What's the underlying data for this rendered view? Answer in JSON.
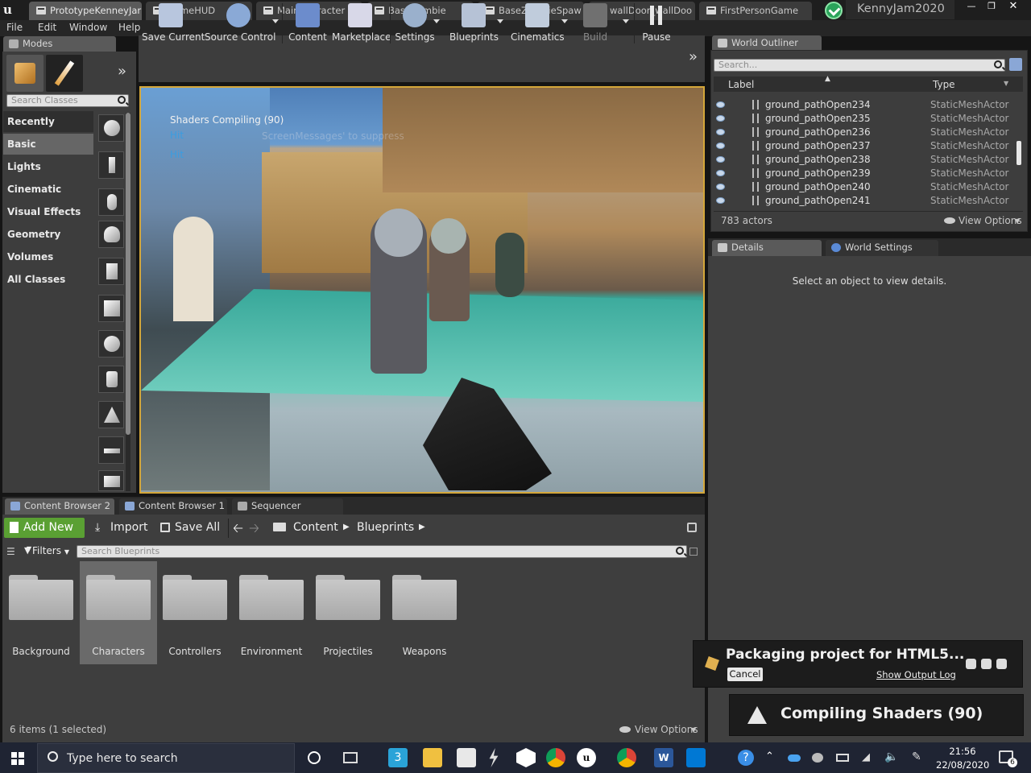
{
  "window": {
    "tabs": [
      {
        "label": "PrototypeKenneyJar"
      },
      {
        "label": "GameHUD"
      },
      {
        "label": "MainCharacter"
      },
      {
        "label": "BaseZombie"
      },
      {
        "label": "BaseZombieSpaw"
      },
      {
        "label": "wallDoor_wallDoo"
      },
      {
        "label": "FirstPersonGame"
      }
    ],
    "project_name": "KennyJam2020"
  },
  "menu": {
    "items": [
      "File",
      "Edit",
      "Window",
      "Help"
    ]
  },
  "modes": {
    "tab_label": "Modes",
    "search_placeholder": "Search Classes",
    "categories": [
      "Recently Placed",
      "Basic",
      "Lights",
      "Cinematic",
      "Visual Effects",
      "Geometry",
      "Volumes",
      "All Classes"
    ]
  },
  "toolbar": {
    "buttons": [
      {
        "label": "Save Current"
      },
      {
        "label": "Source Control"
      },
      {
        "label": "Content"
      },
      {
        "label": "Marketplace"
      },
      {
        "label": "Settings"
      },
      {
        "label": "Blueprints"
      },
      {
        "label": "Cinematics"
      },
      {
        "label": "Build"
      },
      {
        "label": "Pause"
      }
    ]
  },
  "viewport": {
    "overlay_title": "Shaders Compiling (90)",
    "hit1": "Hit",
    "hit2": "Hit",
    "ghost_text": "ScreenMessages' to suppress"
  },
  "outliner": {
    "tab_label": "World Outliner",
    "search_placeholder": "Search...",
    "col_label": "Label",
    "col_type": "Type",
    "rows": [
      {
        "name": "ground_pathOpen234",
        "type": "StaticMeshActor"
      },
      {
        "name": "ground_pathOpen235",
        "type": "StaticMeshActor"
      },
      {
        "name": "ground_pathOpen236",
        "type": "StaticMeshActor"
      },
      {
        "name": "ground_pathOpen237",
        "type": "StaticMeshActor"
      },
      {
        "name": "ground_pathOpen238",
        "type": "StaticMeshActor"
      },
      {
        "name": "ground_pathOpen239",
        "type": "StaticMeshActor"
      },
      {
        "name": "ground_pathOpen240",
        "type": "StaticMeshActor"
      },
      {
        "name": "ground_pathOpen241",
        "type": "StaticMeshActor"
      }
    ],
    "actor_count": "783 actors",
    "view_options": "View Options"
  },
  "details": {
    "tab_details": "Details",
    "tab_world": "World Settings",
    "empty_text": "Select an object to view details."
  },
  "content_browser": {
    "tabs": [
      "Content Browser 2",
      "Content Browser 1",
      "Sequencer"
    ],
    "add_new": "Add New",
    "import": "Import",
    "save_all": "Save All",
    "path": [
      "Content",
      "Blueprints"
    ],
    "filters": "Filters",
    "search_placeholder": "Search Blueprints",
    "folders": [
      "Background",
      "Characters",
      "Controllers",
      "Environment",
      "Projectiles",
      "Weapons"
    ],
    "selected_folder_index": 1,
    "items_count": "6 items (1 selected)",
    "view_options": "View Options"
  },
  "notifications": {
    "packaging": "Packaging project for HTML5...",
    "cancel": "Cancel",
    "show_log": "Show Output Log",
    "compiling": "Compiling Shaders (90)"
  },
  "taskbar": {
    "search_placeholder": "Type here to search",
    "time": "21:56",
    "date": "22/08/2020",
    "notif_count": "6",
    "badge_3": "3"
  },
  "colors": {
    "accent_green": "#5aa033",
    "viewport_border": "#d4a73a",
    "hit_text": "#3a9de0"
  }
}
